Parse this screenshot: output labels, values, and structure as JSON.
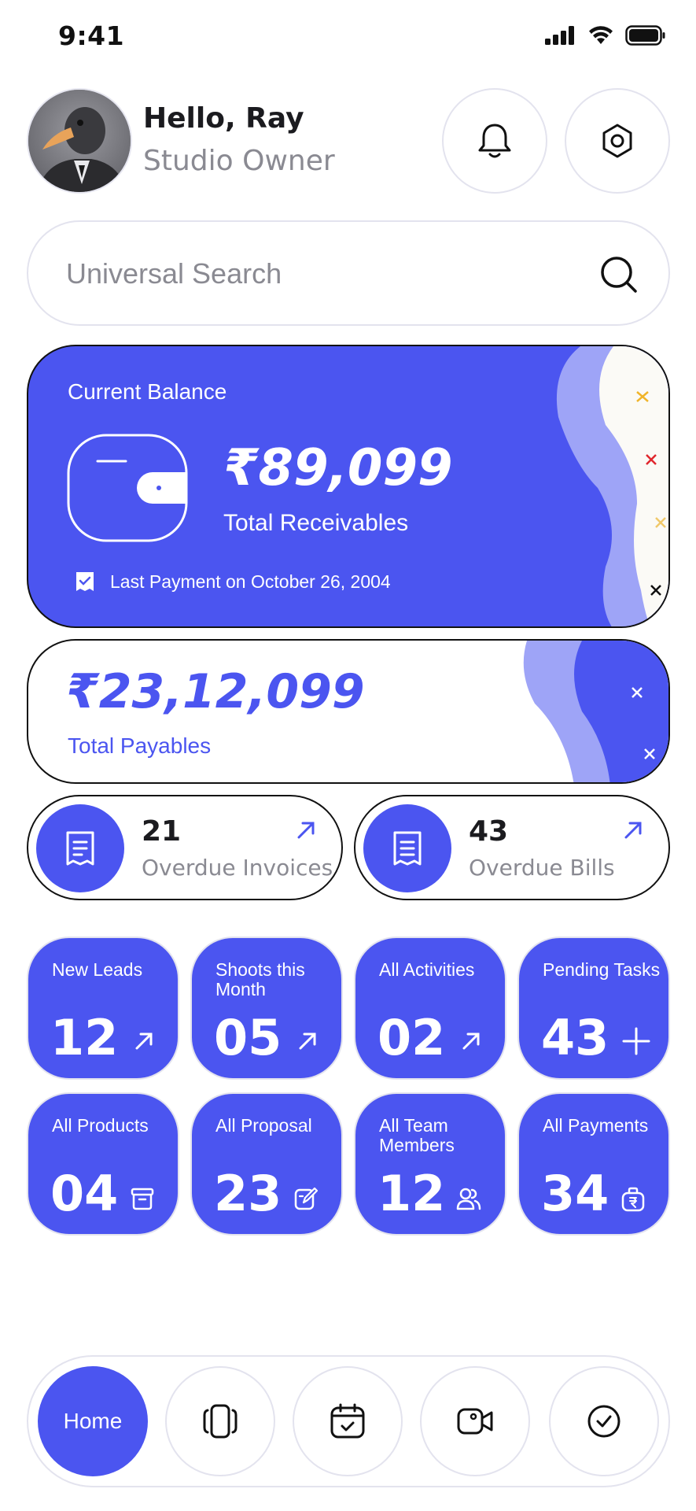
{
  "status_bar": {
    "time": "9:41"
  },
  "header": {
    "greeting": "Hello, Ray",
    "role": "Studio Owner"
  },
  "search": {
    "placeholder": "Universal Search"
  },
  "balance": {
    "label": "Current Balance",
    "amount": "₹89,099",
    "sub_label": "Total Receivables",
    "last_payment": "Last Payment on October 26, 2004"
  },
  "payables": {
    "amount": "₹23,12,099",
    "label": "Total Payables"
  },
  "overdue": [
    {
      "count": "21",
      "label": "Overdue Invoices"
    },
    {
      "count": "43",
      "label": "Overdue Bills"
    }
  ],
  "tiles": [
    {
      "label": "New Leads",
      "value": "12",
      "icon": "arrow-up-right-icon"
    },
    {
      "label": "Shoots this Month",
      "value": "05",
      "icon": "arrow-up-right-icon"
    },
    {
      "label": "All Activities",
      "value": "02",
      "icon": "arrow-up-right-icon"
    },
    {
      "label": "Pending Tasks",
      "value": "43",
      "icon": "plus-icon"
    },
    {
      "label": "All Products",
      "value": "04",
      "icon": "archive-icon"
    },
    {
      "label": "All Proposal",
      "value": "23",
      "icon": "edit-icon"
    },
    {
      "label": "All Team Members",
      "value": "12",
      "icon": "users-icon"
    },
    {
      "label": "All Payments",
      "value": "34",
      "icon": "wallet-rupee-icon"
    }
  ],
  "nav": {
    "home_label": "Home",
    "items": [
      "cards-icon",
      "calendar-check-icon",
      "video-icon",
      "check-circle-icon"
    ]
  },
  "colors": {
    "accent": "#4b55f0",
    "accent_light": "#9ea4f7",
    "text_muted": "#8a8a92"
  }
}
